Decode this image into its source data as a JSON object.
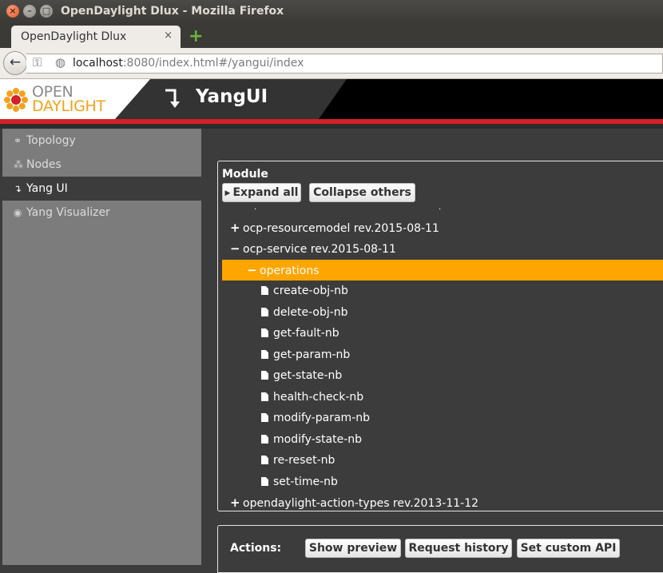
{
  "window": {
    "title": "OpenDaylight Dlux - Mozilla Firefox",
    "close_glyph": "×",
    "min_glyph": "–",
    "max_glyph": "□"
  },
  "tab": {
    "label": "OpenDaylight Dlux",
    "close_glyph": "×",
    "newtab_glyph": "+"
  },
  "nav": {
    "back_glyph": "←",
    "url_host": "localhost",
    "url_rest": ":8080/index.html#/yangui/index"
  },
  "header": {
    "logo_line1": "OPEN",
    "logo_line2": "DAYLIGHT",
    "title": "YangUI"
  },
  "sidebar": {
    "items": [
      {
        "label": "Topology",
        "icon": "link-icon",
        "glyph": "⚭"
      },
      {
        "label": "Nodes",
        "icon": "sitemap-icon",
        "glyph": "⁂"
      },
      {
        "label": "Yang UI",
        "icon": "arrow-down-icon",
        "glyph": "↴"
      },
      {
        "label": "Yang Visualizer",
        "icon": "eye-icon",
        "glyph": "◉"
      }
    ],
    "active_index": 2
  },
  "module": {
    "label": "Module",
    "expand_all": "Expand all",
    "collapse_others": "Collapse others",
    "tree": [
      {
        "toggle": "+",
        "label": "ocp-resourcemodel rev.2015-08-11"
      },
      {
        "toggle": "−",
        "label": "ocp-service rev.2015-08-11"
      },
      {
        "toggle": "−",
        "label": "operations"
      },
      {
        "label": "create-obj-nb"
      },
      {
        "label": "delete-obj-nb"
      },
      {
        "label": "get-fault-nb"
      },
      {
        "label": "get-param-nb"
      },
      {
        "label": "get-state-nb"
      },
      {
        "label": "health-check-nb"
      },
      {
        "label": "modify-param-nb"
      },
      {
        "label": "modify-state-nb"
      },
      {
        "label": "re-reset-nb"
      },
      {
        "label": "set-time-nb"
      },
      {
        "toggle": "+",
        "label": "opendaylight-action-types rev.2013-11-12"
      }
    ]
  },
  "actions": {
    "label": "Actions:",
    "show_preview": "Show preview",
    "request_history": "Request history",
    "set_custom_api": "Set custom API"
  },
  "colors": {
    "selected_row": "#ffa500",
    "brand_red": "#d42027",
    "logo_orange": "#f2a21b"
  }
}
